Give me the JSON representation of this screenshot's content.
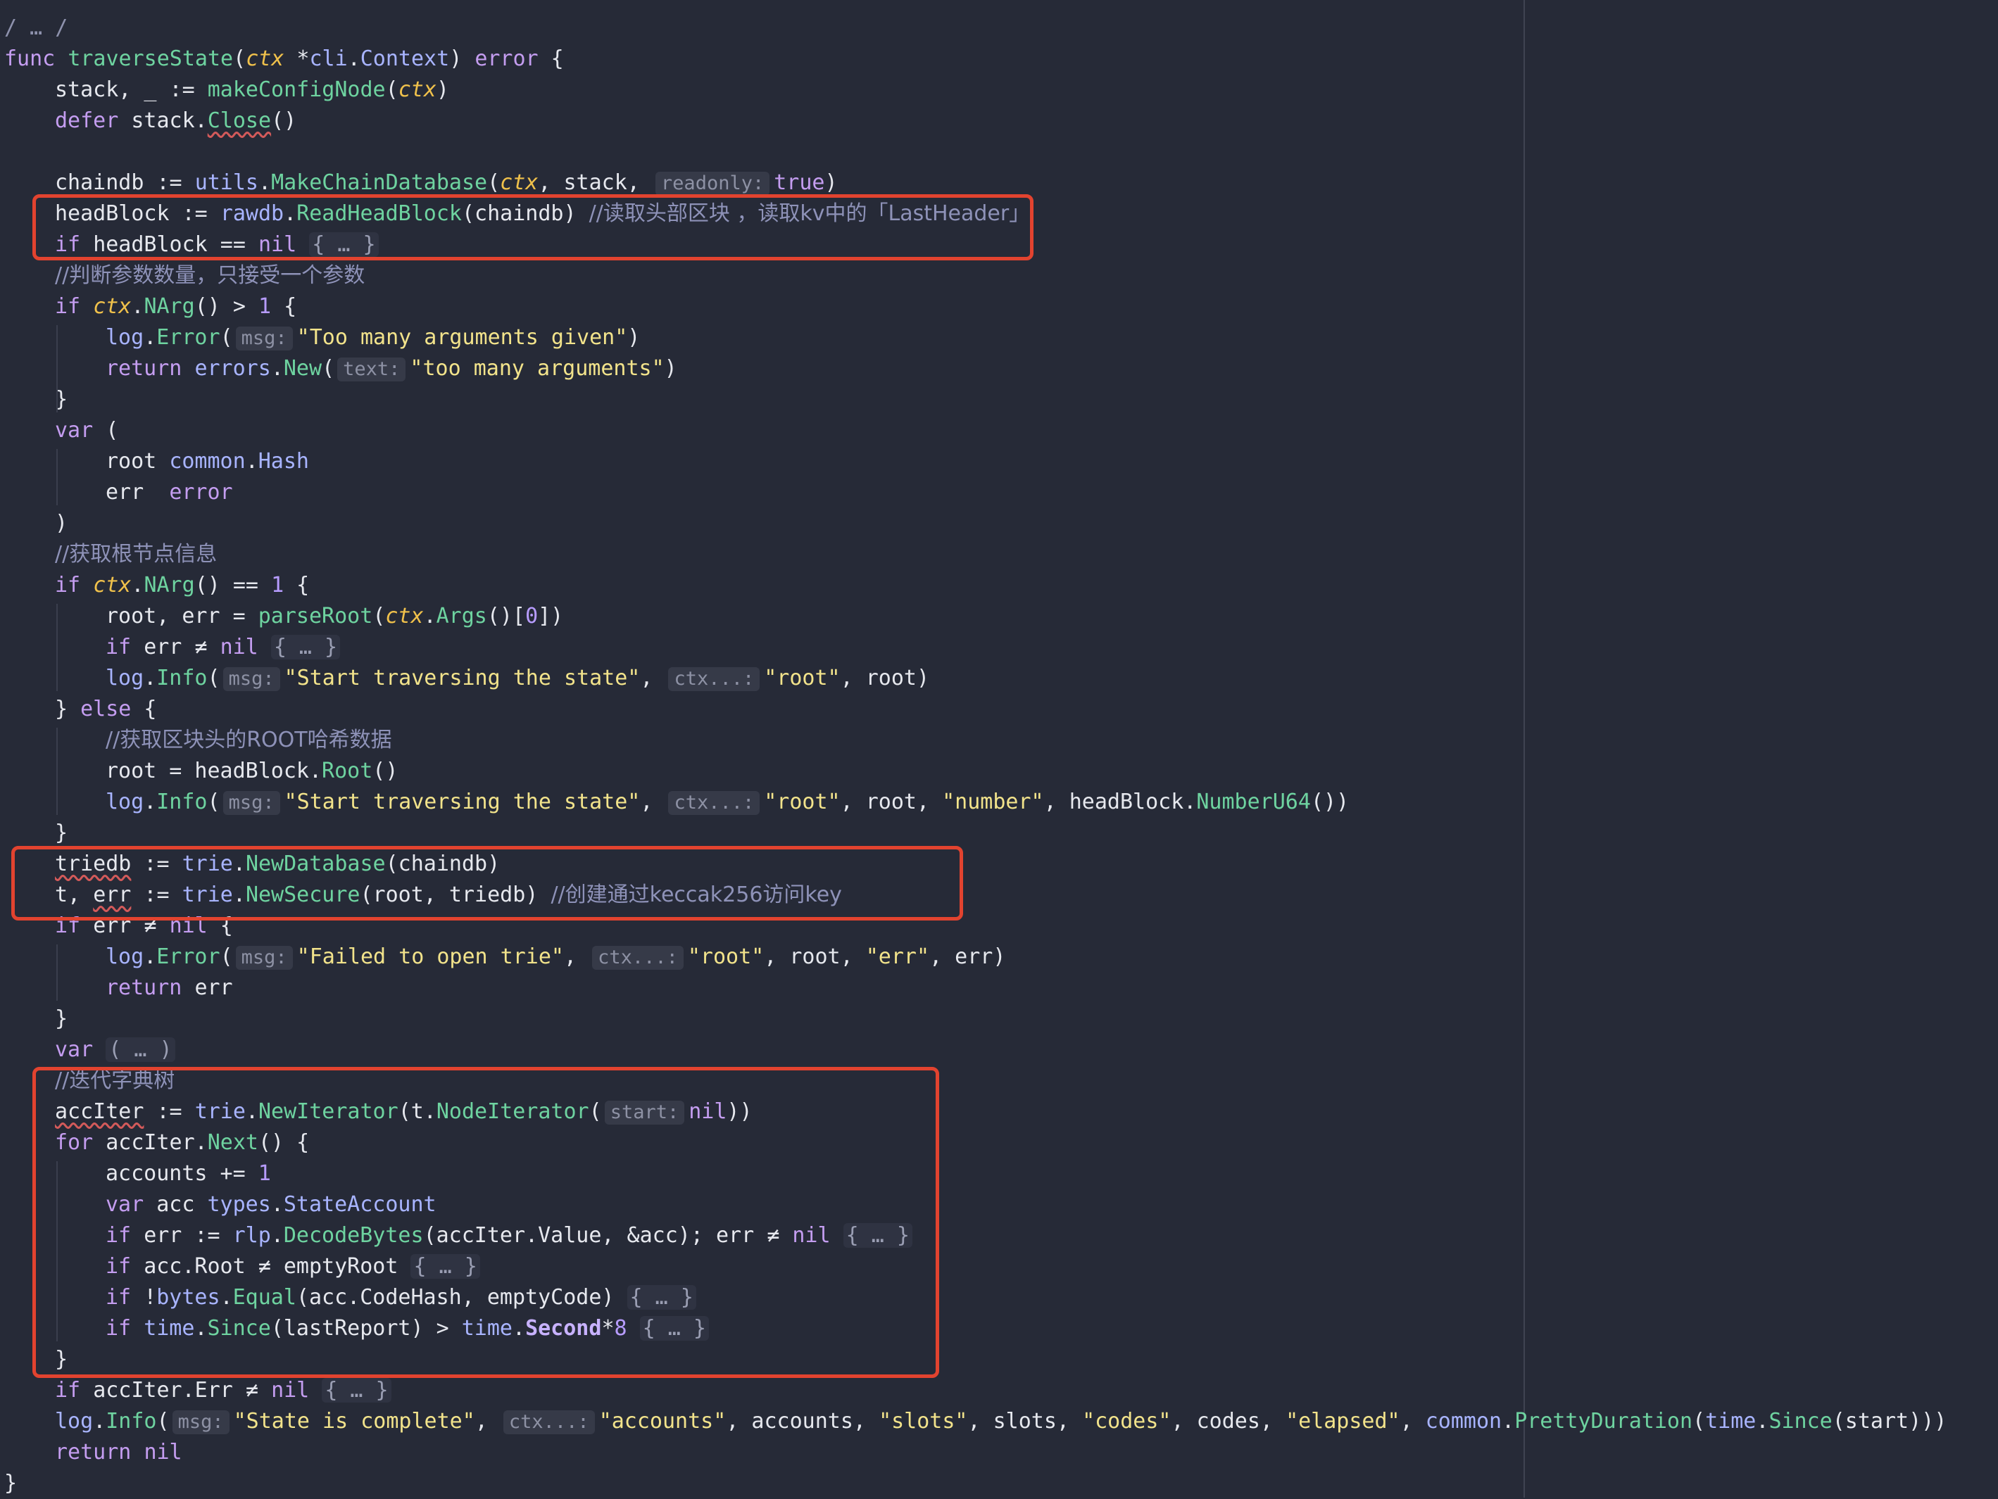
{
  "editor": {
    "language": "Go",
    "colors": {
      "background": "#262a37",
      "highlight_box": "#e2432f"
    },
    "lines": [
      {
        "indent": 0,
        "tokens": [
          [
            "dim",
            "/ … /"
          ]
        ]
      },
      {
        "indent": 0,
        "tokens": [
          [
            "kw",
            "func "
          ],
          [
            "fn",
            "traverseState"
          ],
          [
            "p",
            "("
          ],
          [
            "par",
            "ctx"
          ],
          [
            "p",
            " *"
          ],
          [
            "pkg",
            "cli"
          ],
          [
            "p",
            "."
          ],
          [
            "ty",
            "Context"
          ],
          [
            "p",
            ") "
          ],
          [
            "kw",
            "error"
          ],
          [
            "p",
            " {"
          ]
        ]
      },
      {
        "indent": 1,
        "tokens": [
          [
            "p",
            "stack, _ := "
          ],
          [
            "fn",
            "makeConfigNode"
          ],
          [
            "p",
            "("
          ],
          [
            "par",
            "ctx"
          ],
          [
            "p",
            ")"
          ]
        ]
      },
      {
        "indent": 1,
        "tokens": [
          [
            "kw",
            "defer "
          ],
          [
            "p",
            "stack."
          ],
          [
            "fnsq",
            "Close"
          ],
          [
            "p",
            "()"
          ]
        ]
      },
      {
        "indent": 0,
        "tokens": []
      },
      {
        "indent": 1,
        "tokens": [
          [
            "p",
            "chaindb := "
          ],
          [
            "pkg",
            "utils"
          ],
          [
            "p",
            "."
          ],
          [
            "fn",
            "MakeChainDatabase"
          ],
          [
            "p",
            "("
          ],
          [
            "par",
            "ctx"
          ],
          [
            "p",
            ", stack, "
          ],
          [
            "hint",
            "readonly:"
          ],
          [
            "kw",
            "true"
          ],
          [
            "p",
            ")"
          ]
        ]
      },
      {
        "indent": 1,
        "tokens": [
          [
            "p",
            "headBlock := "
          ],
          [
            "pkg",
            "rawdb"
          ],
          [
            "p",
            "."
          ],
          [
            "fn",
            "ReadHeadBlock"
          ],
          [
            "p",
            "(chaindb) "
          ],
          [
            "cmt",
            "//读取头部区块 ，读取kv中的「LastHeader」"
          ]
        ]
      },
      {
        "indent": 1,
        "tokens": [
          [
            "kw",
            "if "
          ],
          [
            "p",
            "headBlock == "
          ],
          [
            "kw",
            "nil"
          ],
          [
            "p",
            " "
          ],
          [
            "fold",
            "{ … }"
          ]
        ]
      },
      {
        "indent": 1,
        "tokens": [
          [
            "cmt",
            "//判断参数数量，只接受一个参数"
          ]
        ]
      },
      {
        "indent": 1,
        "tokens": [
          [
            "kw",
            "if "
          ],
          [
            "par",
            "ctx"
          ],
          [
            "p",
            "."
          ],
          [
            "fn",
            "NArg"
          ],
          [
            "p",
            "() > "
          ],
          [
            "num",
            "1"
          ],
          [
            "p",
            " {"
          ]
        ]
      },
      {
        "indent": 2,
        "tokens": [
          [
            "pkg",
            "log"
          ],
          [
            "p",
            "."
          ],
          [
            "fn",
            "Error"
          ],
          [
            "p",
            "("
          ],
          [
            "hint",
            "msg:"
          ],
          [
            "str",
            "\"Too many arguments given\""
          ],
          [
            "p",
            ")"
          ]
        ]
      },
      {
        "indent": 2,
        "tokens": [
          [
            "kw",
            "return "
          ],
          [
            "pkg",
            "errors"
          ],
          [
            "p",
            "."
          ],
          [
            "fn",
            "New"
          ],
          [
            "p",
            "("
          ],
          [
            "hint",
            "text:"
          ],
          [
            "str",
            "\"too many arguments\""
          ],
          [
            "p",
            ")"
          ]
        ]
      },
      {
        "indent": 1,
        "tokens": [
          [
            "p",
            "}"
          ]
        ]
      },
      {
        "indent": 1,
        "tokens": [
          [
            "kw",
            "var"
          ],
          [
            "p",
            " ("
          ]
        ]
      },
      {
        "indent": 2,
        "tokens": [
          [
            "p",
            "root "
          ],
          [
            "pkg",
            "common"
          ],
          [
            "p",
            "."
          ],
          [
            "ty",
            "Hash"
          ]
        ]
      },
      {
        "indent": 2,
        "tokens": [
          [
            "p",
            "err  "
          ],
          [
            "kw",
            "error"
          ]
        ]
      },
      {
        "indent": 1,
        "tokens": [
          [
            "p",
            ")"
          ]
        ]
      },
      {
        "indent": 1,
        "tokens": [
          [
            "cmt",
            "//获取根节点信息"
          ]
        ]
      },
      {
        "indent": 1,
        "tokens": [
          [
            "kw",
            "if "
          ],
          [
            "par",
            "ctx"
          ],
          [
            "p",
            "."
          ],
          [
            "fn",
            "NArg"
          ],
          [
            "p",
            "() == "
          ],
          [
            "num",
            "1"
          ],
          [
            "p",
            " {"
          ]
        ]
      },
      {
        "indent": 2,
        "tokens": [
          [
            "p",
            "root, err = "
          ],
          [
            "fn",
            "parseRoot"
          ],
          [
            "p",
            "("
          ],
          [
            "par",
            "ctx"
          ],
          [
            "p",
            "."
          ],
          [
            "fn",
            "Args"
          ],
          [
            "p",
            "()["
          ],
          [
            "num",
            "0"
          ],
          [
            "p",
            "])"
          ]
        ]
      },
      {
        "indent": 2,
        "tokens": [
          [
            "kw",
            "if "
          ],
          [
            "p",
            "err ≠ "
          ],
          [
            "kw",
            "nil"
          ],
          [
            "p",
            " "
          ],
          [
            "fold",
            "{ … }"
          ]
        ]
      },
      {
        "indent": 2,
        "tokens": [
          [
            "pkg",
            "log"
          ],
          [
            "p",
            "."
          ],
          [
            "fn",
            "Info"
          ],
          [
            "p",
            "("
          ],
          [
            "hint",
            "msg:"
          ],
          [
            "str",
            "\"Start traversing the state\""
          ],
          [
            "p",
            ", "
          ],
          [
            "hint",
            "ctx...:"
          ],
          [
            "str",
            "\"root\""
          ],
          [
            "p",
            ", root)"
          ]
        ]
      },
      {
        "indent": 1,
        "tokens": [
          [
            "p",
            "} "
          ],
          [
            "kw",
            "else"
          ],
          [
            "p",
            " {"
          ]
        ]
      },
      {
        "indent": 2,
        "tokens": [
          [
            "cmt",
            "//获取区块头的ROOT哈希数据"
          ]
        ]
      },
      {
        "indent": 2,
        "tokens": [
          [
            "p",
            "root = headBlock."
          ],
          [
            "fn",
            "Root"
          ],
          [
            "p",
            "()"
          ]
        ]
      },
      {
        "indent": 2,
        "tokens": [
          [
            "pkg",
            "log"
          ],
          [
            "p",
            "."
          ],
          [
            "fn",
            "Info"
          ],
          [
            "p",
            "("
          ],
          [
            "hint",
            "msg:"
          ],
          [
            "str",
            "\"Start traversing the state\""
          ],
          [
            "p",
            ", "
          ],
          [
            "hint",
            "ctx...:"
          ],
          [
            "str",
            "\"root\""
          ],
          [
            "p",
            ", root, "
          ],
          [
            "str",
            "\"number\""
          ],
          [
            "p",
            ", headBlock."
          ],
          [
            "fn",
            "NumberU64"
          ],
          [
            "p",
            "())"
          ]
        ]
      },
      {
        "indent": 1,
        "tokens": [
          [
            "p",
            "}"
          ]
        ]
      },
      {
        "indent": 1,
        "tokens": [
          [
            "sq",
            "triedb"
          ],
          [
            "p",
            " := "
          ],
          [
            "pkg",
            "trie"
          ],
          [
            "p",
            "."
          ],
          [
            "fn",
            "NewDatabase"
          ],
          [
            "p",
            "(chaindb)"
          ]
        ]
      },
      {
        "indent": 1,
        "tokens": [
          [
            "p",
            "t, "
          ],
          [
            "sq",
            "err"
          ],
          [
            "p",
            " := "
          ],
          [
            "pkg",
            "trie"
          ],
          [
            "p",
            "."
          ],
          [
            "fn",
            "NewSecure"
          ],
          [
            "p",
            "(root, triedb) "
          ],
          [
            "cmt",
            "//创建通过keccak256访问key"
          ]
        ]
      },
      {
        "indent": 1,
        "tokens": [
          [
            "kw",
            "if "
          ],
          [
            "p",
            "err ≠ "
          ],
          [
            "kw",
            "nil"
          ],
          [
            "p",
            " {"
          ]
        ]
      },
      {
        "indent": 2,
        "tokens": [
          [
            "pkg",
            "log"
          ],
          [
            "p",
            "."
          ],
          [
            "fn",
            "Error"
          ],
          [
            "p",
            "("
          ],
          [
            "hint",
            "msg:"
          ],
          [
            "str",
            "\"Failed to open trie\""
          ],
          [
            "p",
            ", "
          ],
          [
            "hint",
            "ctx...:"
          ],
          [
            "str",
            "\"root\""
          ],
          [
            "p",
            ", root, "
          ],
          [
            "str",
            "\"err\""
          ],
          [
            "p",
            ", err)"
          ]
        ]
      },
      {
        "indent": 2,
        "tokens": [
          [
            "kw",
            "return "
          ],
          [
            "p",
            "err"
          ]
        ]
      },
      {
        "indent": 1,
        "tokens": [
          [
            "p",
            "}"
          ]
        ]
      },
      {
        "indent": 1,
        "tokens": [
          [
            "kw",
            "var"
          ],
          [
            "p",
            " "
          ],
          [
            "fold",
            "( … )"
          ]
        ]
      },
      {
        "indent": 1,
        "tokens": [
          [
            "cmt",
            "//迭代字典树"
          ]
        ]
      },
      {
        "indent": 1,
        "tokens": [
          [
            "sq",
            "accIter"
          ],
          [
            "p",
            " := "
          ],
          [
            "pkg",
            "trie"
          ],
          [
            "p",
            "."
          ],
          [
            "fn",
            "NewIterator"
          ],
          [
            "p",
            "(t."
          ],
          [
            "fn",
            "NodeIterator"
          ],
          [
            "p",
            "("
          ],
          [
            "hint",
            "start:"
          ],
          [
            "kw",
            "nil"
          ],
          [
            "p",
            "))"
          ]
        ]
      },
      {
        "indent": 1,
        "tokens": [
          [
            "kw",
            "for "
          ],
          [
            "p",
            "accIter."
          ],
          [
            "fn",
            "Next"
          ],
          [
            "p",
            "() {"
          ]
        ]
      },
      {
        "indent": 2,
        "tokens": [
          [
            "p",
            "accounts += "
          ],
          [
            "num",
            "1"
          ]
        ]
      },
      {
        "indent": 2,
        "tokens": [
          [
            "kw",
            "var "
          ],
          [
            "p",
            "acc "
          ],
          [
            "pkg",
            "types"
          ],
          [
            "p",
            "."
          ],
          [
            "ty",
            "StateAccount"
          ]
        ]
      },
      {
        "indent": 2,
        "tokens": [
          [
            "kw",
            "if "
          ],
          [
            "p",
            "err := "
          ],
          [
            "pkg",
            "rlp"
          ],
          [
            "p",
            "."
          ],
          [
            "fn",
            "DecodeBytes"
          ],
          [
            "p",
            "(accIter.Value, &acc); err ≠ "
          ],
          [
            "kw",
            "nil"
          ],
          [
            "p",
            " "
          ],
          [
            "fold",
            "{ … }"
          ]
        ]
      },
      {
        "indent": 2,
        "tokens": [
          [
            "kw",
            "if "
          ],
          [
            "p",
            "acc.Root ≠ emptyRoot "
          ],
          [
            "fold",
            "{ … }"
          ]
        ]
      },
      {
        "indent": 2,
        "tokens": [
          [
            "kw",
            "if "
          ],
          [
            "p",
            "!"
          ],
          [
            "pkg",
            "bytes"
          ],
          [
            "p",
            "."
          ],
          [
            "fn",
            "Equal"
          ],
          [
            "p",
            "(acc.CodeHash, emptyCode) "
          ],
          [
            "fold",
            "{ … }"
          ]
        ]
      },
      {
        "indent": 2,
        "tokens": [
          [
            "kw",
            "if "
          ],
          [
            "pkg",
            "time"
          ],
          [
            "p",
            "."
          ],
          [
            "fn",
            "Since"
          ],
          [
            "p",
            "(lastReport) > "
          ],
          [
            "pkg",
            "time"
          ],
          [
            "p",
            "."
          ],
          [
            "bold",
            "Second"
          ],
          [
            "p",
            "*"
          ],
          [
            "num",
            "8"
          ],
          [
            "p",
            " "
          ],
          [
            "fold",
            "{ … }"
          ]
        ]
      },
      {
        "indent": 1,
        "tokens": [
          [
            "p",
            "}"
          ]
        ]
      },
      {
        "indent": 1,
        "tokens": [
          [
            "kw",
            "if "
          ],
          [
            "p",
            "accIter.Err ≠ "
          ],
          [
            "kw",
            "nil"
          ],
          [
            "p",
            " "
          ],
          [
            "fold",
            "{ … }"
          ]
        ]
      },
      {
        "indent": 1,
        "tokens": [
          [
            "pkg",
            "log"
          ],
          [
            "p",
            "."
          ],
          [
            "fn",
            "Info"
          ],
          [
            "p",
            "("
          ],
          [
            "hint",
            "msg:"
          ],
          [
            "str",
            "\"State is complete\""
          ],
          [
            "p",
            ", "
          ],
          [
            "hint",
            "ctx...:"
          ],
          [
            "str",
            "\"accounts\""
          ],
          [
            "p",
            ", accounts, "
          ],
          [
            "str",
            "\"slots\""
          ],
          [
            "p",
            ", slots, "
          ],
          [
            "str",
            "\"codes\""
          ],
          [
            "p",
            ", codes, "
          ],
          [
            "str",
            "\"elapsed\""
          ],
          [
            "p",
            ", "
          ],
          [
            "pkg",
            "common"
          ],
          [
            "p",
            "."
          ],
          [
            "fn",
            "PrettyDuration"
          ],
          [
            "p",
            "("
          ],
          [
            "pkg",
            "time"
          ],
          [
            "p",
            "."
          ],
          [
            "fn",
            "Since"
          ],
          [
            "p",
            "(start)))"
          ]
        ]
      },
      {
        "indent": 1,
        "tokens": [
          [
            "kw",
            "return "
          ],
          [
            "kw",
            "nil"
          ]
        ]
      },
      {
        "indent": 0,
        "tokens": [
          [
            "p",
            "}"
          ]
        ]
      }
    ]
  }
}
